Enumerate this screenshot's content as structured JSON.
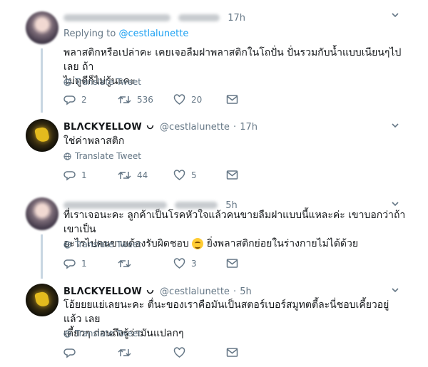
{
  "tweets": [
    {
      "time": "17h",
      "replying_prefix": "Replying to",
      "replying_handle": "@cestlalunette",
      "body_lines": [
        "พลาสติกหรือเปล่าคะ เคยเจอลืมฝาพลาสติกในโถปั่น ปั่นรวมกับน้ำแบบเนียนๆไปเลย ถ้า",
        "ไม่ดูดีก็ไม่รู้นะคะ"
      ],
      "translate": "Translate Tweet",
      "counts": {
        "replies": "2",
        "retweets": "536",
        "likes": "20"
      }
    },
    {
      "name": "BLΛCKYELLOW",
      "handle": "@cestlalunette",
      "sep": "·",
      "time": "17h",
      "body_lines": [
        "ใช่ค่าพลาสติก"
      ],
      "translate": "Translate Tweet",
      "counts": {
        "replies": "1",
        "retweets": "44",
        "likes": "5"
      }
    },
    {
      "time": "5h",
      "body_line1": "ที่เราเจอนะคะ ลูกค้าเป็นโรคหัวใจแล้วคนขายลืมฝาแบบนี้แหละค่ะ เขาบอกว่าถ้าเขาเป็น",
      "body_line2a": "อะไรไปคนขายต้องรับผิดชอบ",
      "body_line2b": "ยิ่งพลาสติกย่อยในร่างกายไม่ได้ด้วย",
      "translate": "Translate Tweet",
      "counts": {
        "replies": "1",
        "retweets": "",
        "likes": "3"
      }
    },
    {
      "name": "BLΛCKYELLOW",
      "handle": "@cestlalunette",
      "sep": "·",
      "time": "5h",
      "body_lines": [
        "โอ้ยยยแย่เลยนะคะ ตื่นะของเราคือมันเป็นสตอร์เบอร์สมูทตตี้ละนี่ชอบเคี้ยวอยู่แล้ว เลย",
        "เคี้ยวๆ ก่อนถึงรู้ว่ามันแปลกๆ"
      ],
      "translate": "Translate Tweet",
      "counts": {
        "replies": "",
        "retweets": "",
        "likes": ""
      }
    }
  ],
  "colors": {
    "link": "#1da1f2",
    "muted": "#657786",
    "thread": "#c8d6e2"
  },
  "icons": [
    "chevron-down-icon",
    "globe-icon",
    "reply-icon",
    "retweet-icon",
    "like-icon",
    "message-icon"
  ]
}
